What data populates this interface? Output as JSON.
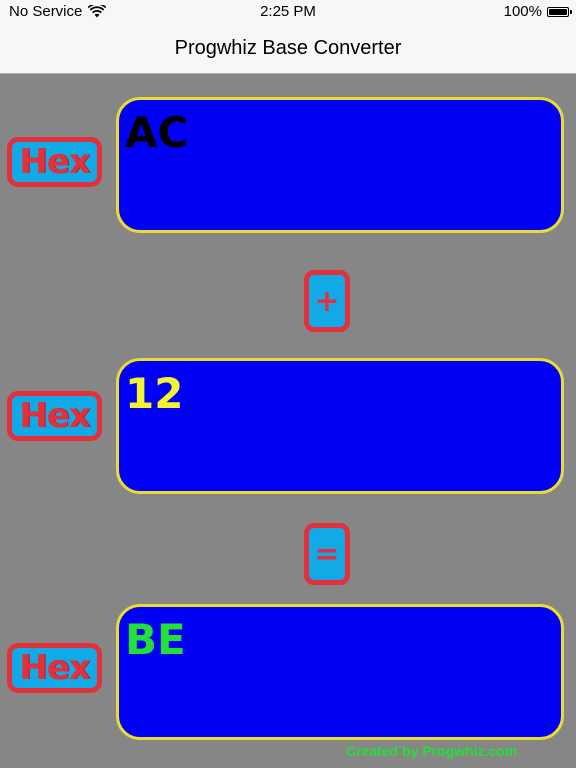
{
  "status_bar": {
    "carrier": "No Service",
    "time": "2:25 PM",
    "battery": "100%",
    "icons": [
      "wifi-icon",
      "battery-icon"
    ]
  },
  "nav": {
    "title": "Progwhiz Base Converter"
  },
  "colors": {
    "background": "#868686",
    "field_fill": "#0000f5",
    "field_border": "#e8dc30",
    "button_fill": "#11a9e6",
    "button_border": "#e3303a",
    "value1_color": "#000000",
    "value2_color": "#f5f232",
    "result_color": "#22e034"
  },
  "operand1": {
    "unit": "Hex",
    "value": "AC"
  },
  "operator": "+",
  "operand2": {
    "unit": "Hex",
    "value": "12"
  },
  "equals": "=",
  "result": {
    "unit": "Hex",
    "value": "BE"
  },
  "footer": "Created by Progwhiz.com"
}
